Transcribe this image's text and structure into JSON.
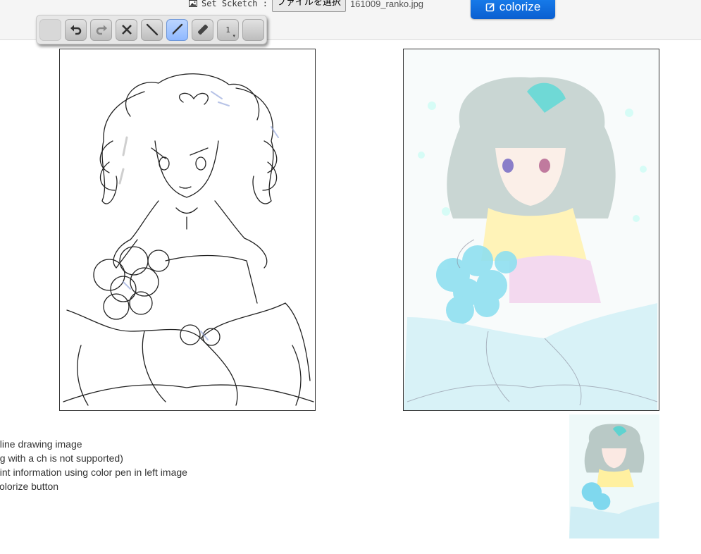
{
  "header": {
    "set_sketch_label": "Set Scketch :",
    "choose_file_label": "ファイルを選択",
    "file_name": "161009_ranko.jpg",
    "colorize_label": "colorize"
  },
  "toolbar": {
    "tools": [
      {
        "name": "blank",
        "icon": "blank-icon"
      },
      {
        "name": "undo",
        "icon": "undo-icon"
      },
      {
        "name": "redo",
        "icon": "redo-icon"
      },
      {
        "name": "clear",
        "icon": "close-icon"
      },
      {
        "name": "line",
        "icon": "line-icon"
      },
      {
        "name": "pen",
        "icon": "pen-icon",
        "active": true
      },
      {
        "name": "eraser",
        "icon": "eraser-icon"
      },
      {
        "name": "size",
        "icon": "size-icon",
        "value": "1"
      },
      {
        "name": "color",
        "icon": "color-swatch-icon"
      }
    ]
  },
  "instructions": [
    "t line drawing image",
    "ng with a ch is not supported)",
    "hint information using color pen in left image",
    " colorize button"
  ],
  "colors": {
    "accent": "#0a6ee0",
    "toolbar_bg": "#e7e7e7",
    "active_tool": "#9fc2ff"
  }
}
